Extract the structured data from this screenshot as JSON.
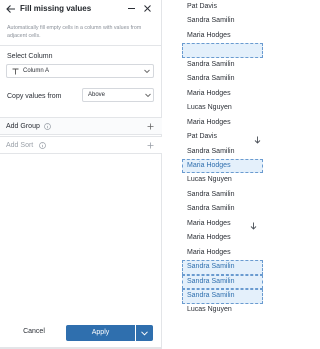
{
  "panel": {
    "title": "Fill missing values",
    "description": "Automatically fill empty cells in a column with values from adjacent cells.",
    "select_column_label": "Select Column",
    "column_value": "Column A",
    "copy_label": "Copy values from",
    "copy_value": "Above",
    "add_group_label": "Add Group",
    "add_sort_label": "Add Sort",
    "cancel_label": "Cancel",
    "apply_label": "Apply"
  },
  "colors": {
    "accent": "#2f6fae",
    "fill_highlight": "#e4f0fb"
  },
  "grid": {
    "cells": [
      {
        "text": "Pat Davis",
        "state": "normal"
      },
      {
        "text": "Sandra Samilin",
        "state": "normal"
      },
      {
        "text": "Maria Hodges",
        "state": "normal"
      },
      {
        "text": "",
        "state": "empty"
      },
      {
        "text": "Sandra Samilin",
        "state": "normal"
      },
      {
        "text": "Sandra Samilin",
        "state": "normal"
      },
      {
        "text": "Maria Hodges",
        "state": "normal"
      },
      {
        "text": "Lucas Nguyen",
        "state": "normal"
      },
      {
        "text": "Maria Hodges",
        "state": "normal"
      },
      {
        "text": "Pat Davis",
        "state": "normal"
      },
      {
        "text": "Sandra Samilin",
        "state": "normal"
      },
      {
        "text": "Maria Hodges",
        "state": "filled"
      },
      {
        "text": "Lucas Nguyen",
        "state": "normal"
      },
      {
        "text": "Sandra Samilin",
        "state": "normal"
      },
      {
        "text": "Sandra Samilin",
        "state": "normal"
      },
      {
        "text": "Maria Hodges",
        "state": "normal"
      },
      {
        "text": "Maria Hodges",
        "state": "normal"
      },
      {
        "text": "Maria Hodges",
        "state": "normal"
      },
      {
        "text": "Sandra Samilin",
        "state": "filled"
      },
      {
        "text": "Sandra Samilin",
        "state": "filled"
      },
      {
        "text": "Sandra Samilin",
        "state": "filled"
      },
      {
        "text": "Lucas Nguyen",
        "state": "normal"
      }
    ]
  }
}
